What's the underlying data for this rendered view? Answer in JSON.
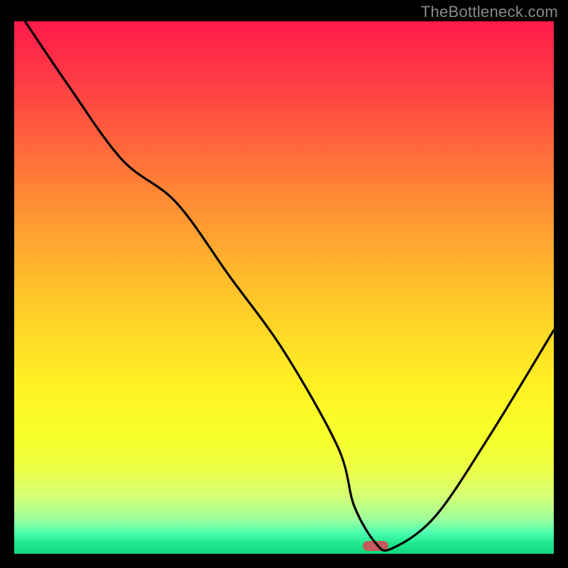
{
  "watermark": "TheBottleneck.com",
  "chart_data": {
    "type": "line",
    "title": "",
    "xlabel": "",
    "ylabel": "",
    "xlim": [
      0,
      100
    ],
    "ylim": [
      0,
      100
    ],
    "grid": false,
    "background_gradient": {
      "orientation": "vertical",
      "stops": [
        {
          "pos": 0.0,
          "color": "#ff1a4a"
        },
        {
          "pos": 0.2,
          "color": "#ff5a3e"
        },
        {
          "pos": 0.46,
          "color": "#ffd827"
        },
        {
          "pos": 0.7,
          "color": "#fff423"
        },
        {
          "pos": 0.9,
          "color": "#9eff9b"
        },
        {
          "pos": 1.0,
          "color": "#12d87e"
        }
      ]
    },
    "series": [
      {
        "name": "bottleneck-curve",
        "type": "line",
        "color": "#000000",
        "x": [
          2,
          10,
          20,
          30,
          40,
          50,
          60,
          63,
          67,
          70,
          78,
          88,
          100
        ],
        "y": [
          100,
          88,
          74,
          66,
          52,
          38,
          20,
          9,
          2,
          1,
          7,
          22,
          42
        ]
      }
    ],
    "marker": {
      "color": "#c55a5a",
      "x_center": 67,
      "y_center": 1.5,
      "width_pct": 4.7,
      "height_pct": 1.9
    }
  }
}
